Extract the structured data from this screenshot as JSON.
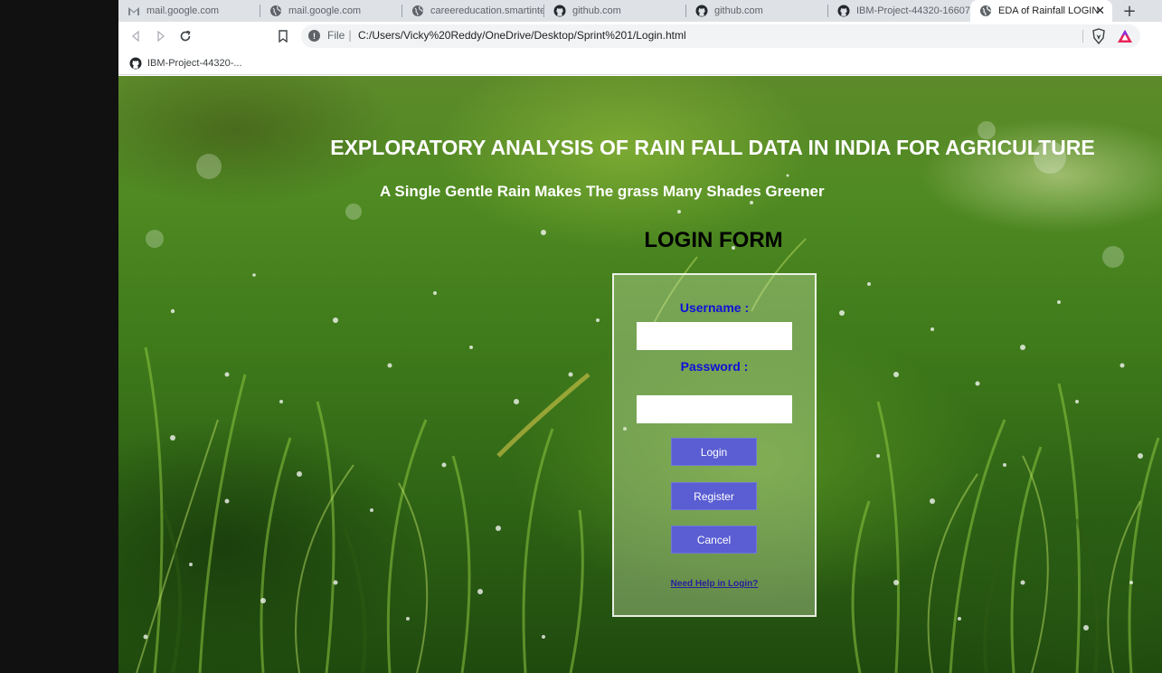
{
  "browser": {
    "tabs": [
      {
        "label": "mail.google.com",
        "icon": "gmail-icon"
      },
      {
        "label": "mail.google.com",
        "icon": "globe-icon"
      },
      {
        "label": "careereducation.smartinter",
        "icon": "globe-icon"
      },
      {
        "label": "github.com",
        "icon": "github-icon"
      },
      {
        "label": "github.com",
        "icon": "github-icon"
      },
      {
        "label": "IBM-Project-44320-16607",
        "icon": "github-icon"
      },
      {
        "label": "EDA of Rainfall LOGIN",
        "icon": "globe-icon",
        "active": true
      }
    ],
    "new_tab": "+",
    "close_tab": "✕",
    "address": {
      "scheme_label": "File",
      "separator": "|",
      "url": "C:/Users/Vicky%20Reddy/OneDrive/Desktop/Sprint%201/Login.html"
    },
    "bookmarks": [
      {
        "label": "IBM-Project-44320-...",
        "icon": "github-icon"
      }
    ]
  },
  "page": {
    "title": "EXPLORATORY ANALYSIS OF RAIN FALL DATA IN INDIA FOR AGRICULTURE",
    "subtitle": "A Single Gentle Rain Makes The grass Many Shades Greener",
    "form_heading": "LOGIN FORM",
    "form": {
      "username_label": "Username :",
      "username_value": "",
      "password_label": "Password :",
      "password_value": "",
      "login_label": "Login",
      "register_label": "Register",
      "cancel_label": "Cancel",
      "help_link": "Need Help in Login?"
    }
  },
  "colors": {
    "label_blue": "#1010d8",
    "button_bg": "#5a5ed2",
    "help_link": "#2a1e9c",
    "tabstrip_bg": "#dee1e6"
  }
}
